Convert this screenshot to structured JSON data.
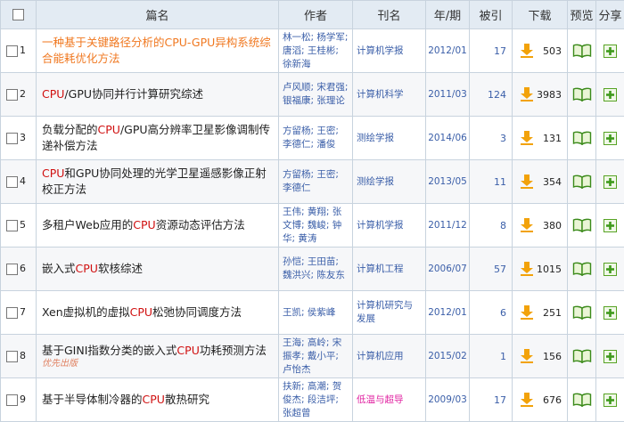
{
  "header": {
    "title": "篇名",
    "authors": "作者",
    "journal": "刊名",
    "year": "年/期",
    "cited": "被引",
    "download": "下载",
    "preview": "预览",
    "share": "分享"
  },
  "rows": [
    {
      "num": "1",
      "title_pre": "一种基于关键路径分析的",
      "title_kw": "CPU-GPU",
      "title_post": "异构系统综合能耗优化方法",
      "tag": "",
      "authors": "林一松; 杨学军; 唐滔; 王桂彬; 徐新海",
      "journal": "计算机学报",
      "year": "2012/01",
      "cited": "17",
      "downloads": "503"
    },
    {
      "num": "2",
      "title_pre": "",
      "title_kw": "CPU",
      "title_post": "/GPU协同并行计算研究综述",
      "tag": "",
      "authors": "卢风顺; 宋君强; 银福康; 张理论",
      "journal": "计算机科学",
      "year": "2011/03",
      "cited": "124",
      "downloads": "3983"
    },
    {
      "num": "3",
      "title_pre": "负载分配的",
      "title_kw": "CPU",
      "title_post": "/GPU高分辨率卫星影像调制传递补偿方法",
      "tag": "",
      "authors": "方留杨; 王密; 李德仁; 潘俊",
      "journal": "测绘学报",
      "year": "2014/06",
      "cited": "3",
      "downloads": "131"
    },
    {
      "num": "4",
      "title_pre": "",
      "title_kw": "CPU",
      "title_post": "和GPU协同处理的光学卫星遥感影像正射校正方法",
      "tag": "",
      "authors": "方留杨; 王密; 李德仁",
      "journal": "测绘学报",
      "year": "2013/05",
      "cited": "11",
      "downloads": "354"
    },
    {
      "num": "5",
      "title_pre": "多租户Web应用的",
      "title_kw": "CPU",
      "title_post": "资源动态评估方法",
      "tag": "",
      "authors": "王伟; 黄翔; 张文博; 魏峻; 钟华; 黄涛",
      "journal": "计算机学报",
      "year": "2011/12",
      "cited": "8",
      "downloads": "380"
    },
    {
      "num": "6",
      "title_pre": "嵌入式",
      "title_kw": "CPU",
      "title_post": "软核综述",
      "tag": "",
      "authors": "孙恺; 王田苗; 魏洪兴; 陈友东",
      "journal": "计算机工程",
      "year": "2006/07",
      "cited": "57",
      "downloads": "1015"
    },
    {
      "num": "7",
      "title_pre": "Xen虚拟机的虚拟",
      "title_kw": "CPU",
      "title_post": "松弛协同调度方法",
      "tag": "",
      "authors": "王凯; 侯紫峰",
      "journal": "计算机研究与发展",
      "year": "2012/01",
      "cited": "6",
      "downloads": "251"
    },
    {
      "num": "8",
      "title_pre": "基于GINI指数分类的嵌入式",
      "title_kw": "CPU",
      "title_post": "功耗预测方法",
      "tag": "优先出版",
      "authors": "王海; 高岭; 宋振孝; 戴小平; 卢怡杰",
      "journal": "计算机应用",
      "year": "2015/02",
      "cited": "1",
      "downloads": "156"
    },
    {
      "num": "9",
      "title_pre": "基于半导体制冷器的",
      "title_kw": "CPU",
      "title_post": "散热研究",
      "tag": "",
      "authors": "扶新; 高潮; 贺俊杰; 段洁坪; 张超曾",
      "journal": "低温与超导",
      "year": "2009/03",
      "cited": "17",
      "downloads": "676"
    }
  ]
}
